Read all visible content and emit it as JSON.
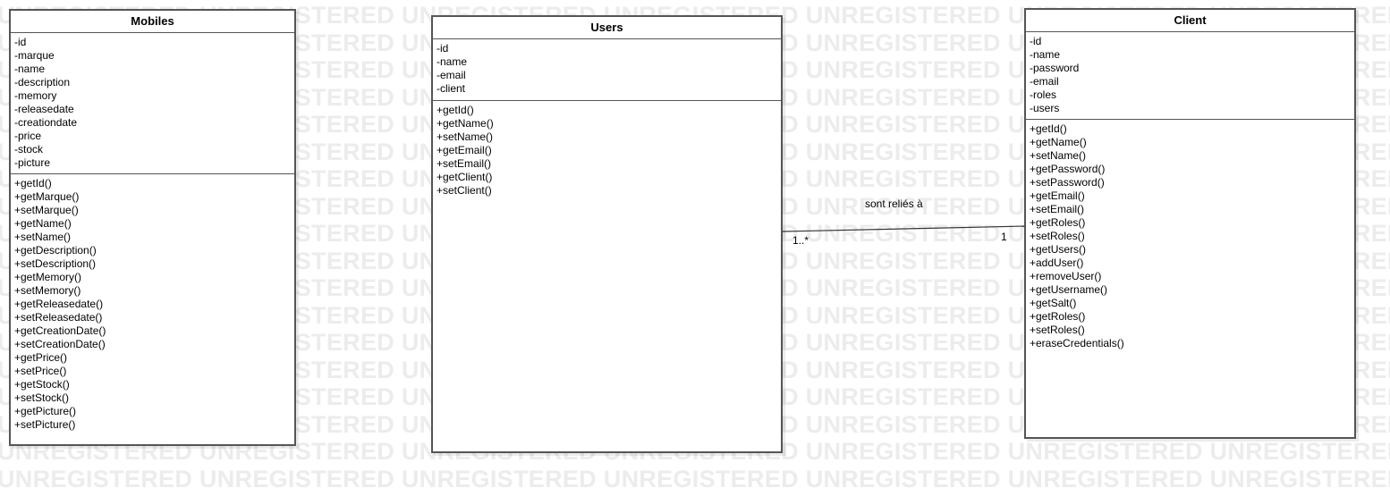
{
  "watermark": {
    "text": "UNREGISTERED UNREGISTERED UNREGISTERED UNREGISTERED UNREGISTERED UNREGISTERED UNREGISTERED UNREGISTERED UNREGISTERED"
  },
  "classes": [
    {
      "name": "Mobiles",
      "attributes": [
        "-id",
        "-marque",
        "-name",
        "-description",
        "-memory",
        "-releasedate",
        "-creationdate",
        "-price",
        "-stock",
        "-picture"
      ],
      "methods": [
        "+getId()",
        "+getMarque()",
        "+setMarque()",
        "+getName()",
        "+setName()",
        "+getDescription()",
        "+setDescription()",
        "+getMemory()",
        "+setMemory()",
        "+getReleasedate()",
        "+setReleasedate()",
        "+getCreationDate()",
        "+setCreationDate()",
        "+getPrice()",
        "+setPrice()",
        "+getStock()",
        "+setStock()",
        "+getPicture()",
        "+setPicture()"
      ]
    },
    {
      "name": "Users",
      "attributes": [
        "-id",
        "-name",
        "-email",
        "-client"
      ],
      "methods": [
        "+getId()",
        "+getName()",
        "+setName()",
        "+getEmail()",
        "+setEmail()",
        "+getClient()",
        "+setClient()"
      ]
    },
    {
      "name": "Client",
      "attributes": [
        "-id",
        "-name",
        "-password",
        "-email",
        "-roles",
        "-users"
      ],
      "methods": [
        "+getId()",
        "+getName()",
        "+setName()",
        "+getPassword()",
        "+setPassword()",
        "+getEmail()",
        "+setEmail()",
        "+getRoles()",
        "+setRoles()",
        "+getUsers()",
        "+addUser()",
        "+removeUser()",
        "+getUsername()",
        "+getSalt()",
        "+getRoles()",
        "+setRoles()",
        "+eraseCredentials()"
      ]
    }
  ],
  "association": {
    "label": "sont reliés à",
    "source_multiplicity": "1..*",
    "target_multiplicity": "1"
  }
}
